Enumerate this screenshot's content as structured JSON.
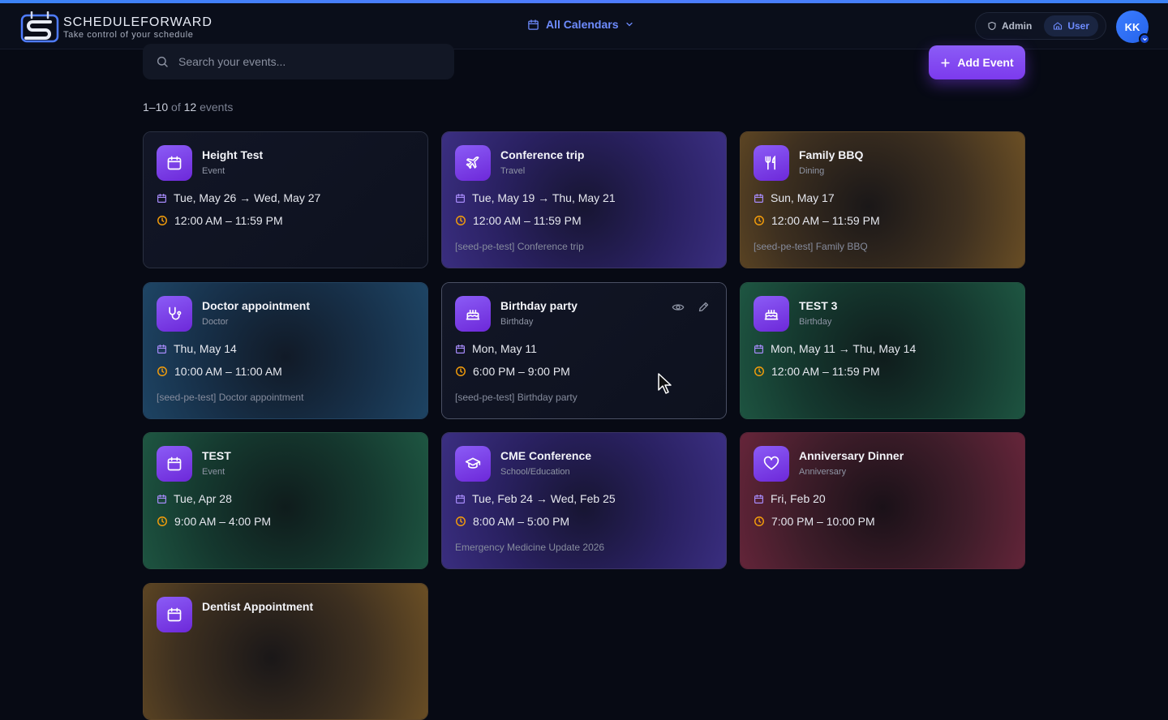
{
  "header": {
    "logo_title": "SCHEDULEFORWARD",
    "logo_subtitle": "Take control of your schedule",
    "calendar_select": "All Calendars",
    "roles": [
      {
        "label": "Admin",
        "icon": "shield-icon",
        "active": false
      },
      {
        "label": "User",
        "icon": "home-icon",
        "active": true
      }
    ],
    "avatar_initials": "KK"
  },
  "toolbar": {
    "search_placeholder": "Search your events...",
    "add_label": "Add Event"
  },
  "count": {
    "range": "1–10",
    "of": "of",
    "total": "12",
    "unit": "events"
  },
  "colors": {
    "accent": "#7c3aed",
    "link": "#6e8cff",
    "time_icon": "#f59e0b",
    "date_icon": "#a78bfa"
  },
  "events": [
    {
      "title": "Height Test",
      "type": "Event",
      "icon": "calendar-icon",
      "date": "Tue, May 26 → Wed, May 27",
      "time": "12:00 AM – 11:59 PM",
      "desc": "",
      "theme": "default"
    },
    {
      "title": "Conference trip",
      "type": "Travel",
      "icon": "plane-icon",
      "date": "Tue, May 19 → Thu, May 21",
      "time": "12:00 AM – 11:59 PM",
      "desc": "[seed-pe-test] Conference trip",
      "theme": "purple"
    },
    {
      "title": "Family BBQ",
      "type": "Dining",
      "icon": "fork-knife-icon",
      "date": "Sun, May 17",
      "time": "12:00 AM – 11:59 PM",
      "desc": "[seed-pe-test] Family BBQ",
      "theme": "amber"
    },
    {
      "title": "Doctor appointment",
      "type": "Doctor",
      "icon": "stethoscope-icon",
      "date": "Thu, May 14",
      "time": "10:00 AM – 11:00 AM",
      "desc": "[seed-pe-test] Doctor appointment",
      "theme": "blue"
    },
    {
      "title": "Birthday party",
      "type": "Birthday",
      "icon": "cake-icon",
      "date": "Mon, May 11",
      "time": "6:00 PM – 9:00 PM",
      "desc": "[seed-pe-test] Birthday party",
      "theme": "default",
      "hover": true
    },
    {
      "title": "TEST 3",
      "type": "Birthday",
      "icon": "cake-icon",
      "date": "Mon, May 11 → Thu, May 14",
      "time": "12:00 AM – 11:59 PM",
      "desc": "",
      "theme": "green"
    },
    {
      "title": "TEST",
      "type": "Event",
      "icon": "calendar-icon",
      "date": "Tue, Apr 28",
      "time": "9:00 AM – 4:00 PM",
      "desc": "",
      "theme": "green"
    },
    {
      "title": "CME Conference",
      "type": "School/Education",
      "icon": "graduation-cap-icon",
      "date": "Tue, Feb 24 → Wed, Feb 25",
      "time": "8:00 AM – 5:00 PM",
      "desc": "Emergency Medicine Update 2026",
      "theme": "purple"
    },
    {
      "title": "Anniversary Dinner",
      "type": "Anniversary",
      "icon": "heart-icon",
      "date": "Fri, Feb 20",
      "time": "7:00 PM – 10:00 PM",
      "desc": "",
      "theme": "red"
    },
    {
      "title": "Dentist Appointment",
      "type": "",
      "icon": "calendar-icon",
      "date": "",
      "time": "",
      "desc": "",
      "theme": "amber"
    }
  ]
}
